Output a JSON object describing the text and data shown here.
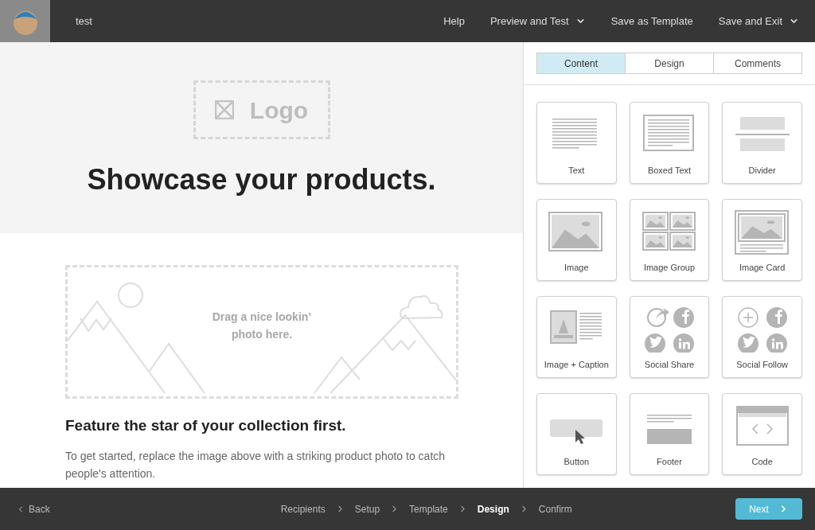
{
  "header": {
    "title": "test",
    "menu": [
      {
        "label": "Help",
        "dropdown": false
      },
      {
        "label": "Preview and Test",
        "dropdown": true
      },
      {
        "label": "Save as Template",
        "dropdown": false
      },
      {
        "label": "Save and Exit",
        "dropdown": true
      }
    ]
  },
  "canvas": {
    "logo_placeholder": "Logo",
    "headline": "Showcase your products.",
    "image_placeholder": "Drag a nice lookin’ photo here.",
    "heading": "Feature the star of your collection first.",
    "paragraph": "To get started, replace the image above with a striking product photo to catch people's attention."
  },
  "panel": {
    "tabs": [
      {
        "label": "Content",
        "selected": true
      },
      {
        "label": "Design",
        "selected": false
      },
      {
        "label": "Comments",
        "selected": false
      }
    ],
    "blocks": [
      {
        "kind": "text",
        "label": "Text"
      },
      {
        "kind": "boxed",
        "label": "Boxed Text"
      },
      {
        "kind": "divider",
        "label": "Divider"
      },
      {
        "kind": "image",
        "label": "Image"
      },
      {
        "kind": "group",
        "label": "Image Group"
      },
      {
        "kind": "card",
        "label": "Image Card"
      },
      {
        "kind": "caption",
        "label": "Image + Caption"
      },
      {
        "kind": "share",
        "label": "Social Share"
      },
      {
        "kind": "follow",
        "label": "Social Follow"
      },
      {
        "kind": "button",
        "label": "Button"
      },
      {
        "kind": "footer",
        "label": "Footer"
      },
      {
        "kind": "code",
        "label": "Code"
      }
    ]
  },
  "footer": {
    "back": "Back",
    "steps": [
      {
        "label": "Recipients",
        "selected": false
      },
      {
        "label": "Setup",
        "selected": false
      },
      {
        "label": "Template",
        "selected": false
      },
      {
        "label": "Design",
        "selected": true
      },
      {
        "label": "Confirm",
        "selected": false
      }
    ],
    "next": "Next"
  }
}
